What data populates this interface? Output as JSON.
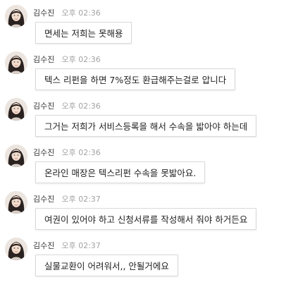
{
  "sender_name": "김수진",
  "messages": [
    {
      "time": "오후 02:36",
      "text": "면세는 저희는 못해용"
    },
    {
      "time": "오후 02:36",
      "text": "텍스 리펀을 하면 7%정도 환급해주는걸로 압니다"
    },
    {
      "time": "오후 02:36",
      "text": "그거는 저희가 서비스등록을 해서 수속을 밟아야 하는데"
    },
    {
      "time": "오후 02:36",
      "text": "온라인 매장은 텍스리펀 수속을 못밟아요."
    },
    {
      "time": "오후 02:37",
      "text": "여권이 있어야 하고 신청서류를 작성해서 줘야 하거든요"
    },
    {
      "time": "오후 02:37",
      "text": "실물교환이 어려워서,, 안될거에요"
    }
  ],
  "colors": {
    "bubble_border": "#d9d9d9",
    "time_text": "#a3a3a3",
    "sender_text": "#333333"
  },
  "icons": {
    "avatar": "profile-photo"
  }
}
